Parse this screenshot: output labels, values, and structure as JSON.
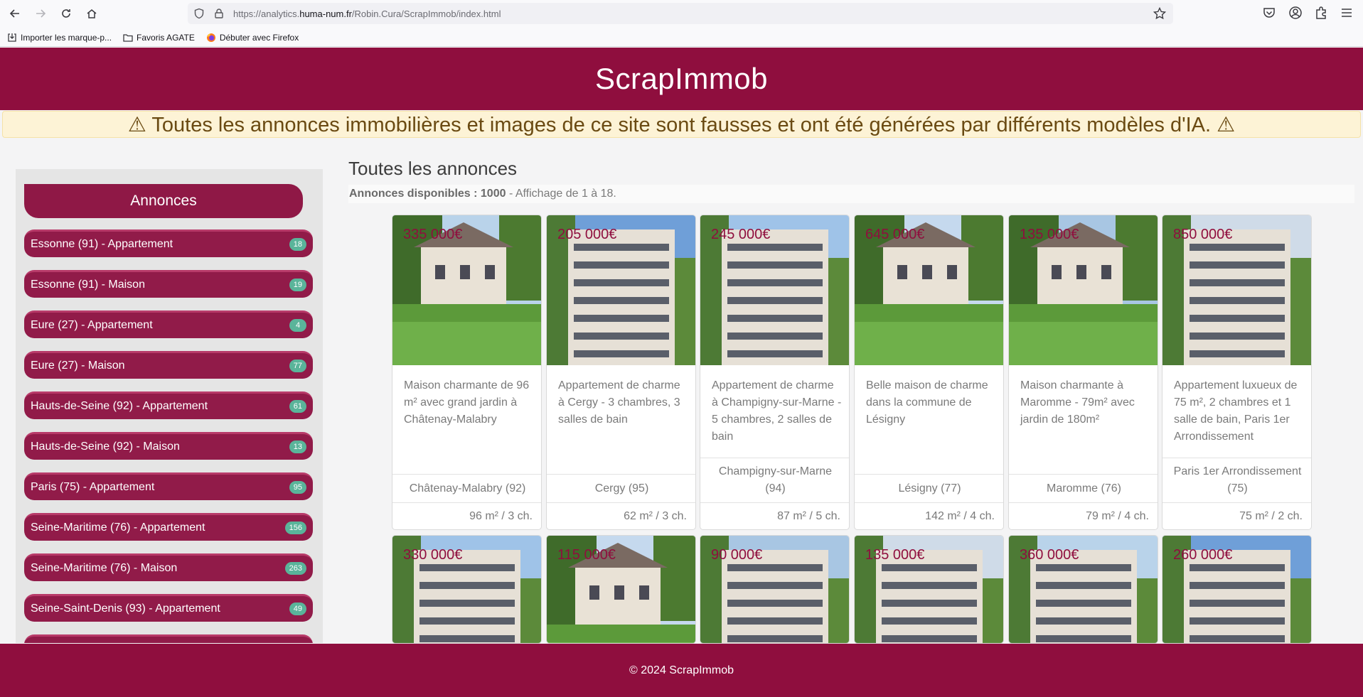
{
  "browser": {
    "url_prefix": "https://analytics.",
    "url_domain": "huma-num.fr",
    "url_path": "/Robin.Cura/ScrapImmob/index.html",
    "bookmarks": [
      {
        "label": "Importer les marque-p...",
        "icon": "import-icon"
      },
      {
        "label": "Favoris AGATE",
        "icon": "folder-icon"
      },
      {
        "label": "Débuter avec Firefox",
        "icon": "firefox-icon"
      }
    ]
  },
  "header": {
    "title": "ScrapImmob"
  },
  "warning": {
    "text": "⚠ Toutes les annonces immobilières et images de ce site sont fausses et ont été générées par différents modèles d'IA. ⚠"
  },
  "sidebar": {
    "title": "Annonces",
    "items": [
      {
        "label": "Essonne (91) - Appartement",
        "count": "18"
      },
      {
        "label": "Essonne (91) - Maison",
        "count": "19"
      },
      {
        "label": "Eure (27) - Appartement",
        "count": "4"
      },
      {
        "label": "Eure (27) - Maison",
        "count": "77"
      },
      {
        "label": "Hauts-de-Seine (92) - Appartement",
        "count": "61"
      },
      {
        "label": "Hauts-de-Seine (92) - Maison",
        "count": "13"
      },
      {
        "label": "Paris (75) - Appartement",
        "count": "95"
      },
      {
        "label": "Seine-Maritime (76) - Appartement",
        "count": "156"
      },
      {
        "label": "Seine-Maritime (76) - Maison",
        "count": "263"
      },
      {
        "label": "Seine-Saint-Denis (93) - Appartement",
        "count": "49"
      }
    ]
  },
  "main": {
    "title": "Toutes les annonces",
    "available_label": "Annonces disponibles : 1000",
    "display_label": " - Affichage de 1 à 18."
  },
  "listings": [
    {
      "price": "335 000€",
      "desc": "Maison charmante de 96 m² avec grand jardin à Châtenay-Malabry",
      "city": "Châtenay-Malabry (92)",
      "surface": "96 m² / 3 ch."
    },
    {
      "price": "205 000€",
      "desc": "Appartement de charme à Cergy - 3 chambres, 3 salles de bain",
      "city": "Cergy (95)",
      "surface": "62 m² / 3 ch."
    },
    {
      "price": "245 000€",
      "desc": "Appartement de charme à Champigny-sur-Marne - 5 chambres, 2 salles de bain",
      "city": "Champigny-sur-Marne (94)",
      "surface": "87 m² / 5 ch."
    },
    {
      "price": "645 000€",
      "desc": "Belle maison de charme dans la commune de Lésigny",
      "city": "Lésigny (77)",
      "surface": "142 m² / 4 ch."
    },
    {
      "price": "135 000€",
      "desc": "Maison charmante à Maromme - 79m² avec jardin de 180m²",
      "city": "Maromme (76)",
      "surface": "79 m² / 4 ch."
    },
    {
      "price": "850 000€",
      "desc": "Appartement luxueux de 75 m², 2 chambres et 1 salle de bain, Paris 1er Arrondissement",
      "city": "Paris 1er Arrondissement (75)",
      "surface": "75 m² / 2 ch."
    }
  ],
  "listings_row2": [
    {
      "price": "330 000€"
    },
    {
      "price": "115 000€"
    },
    {
      "price": "90 000€"
    },
    {
      "price": "135 000€"
    },
    {
      "price": "360 000€"
    },
    {
      "price": "260 000€"
    }
  ],
  "footer": {
    "text": "© 2024 ScrapImmob"
  }
}
